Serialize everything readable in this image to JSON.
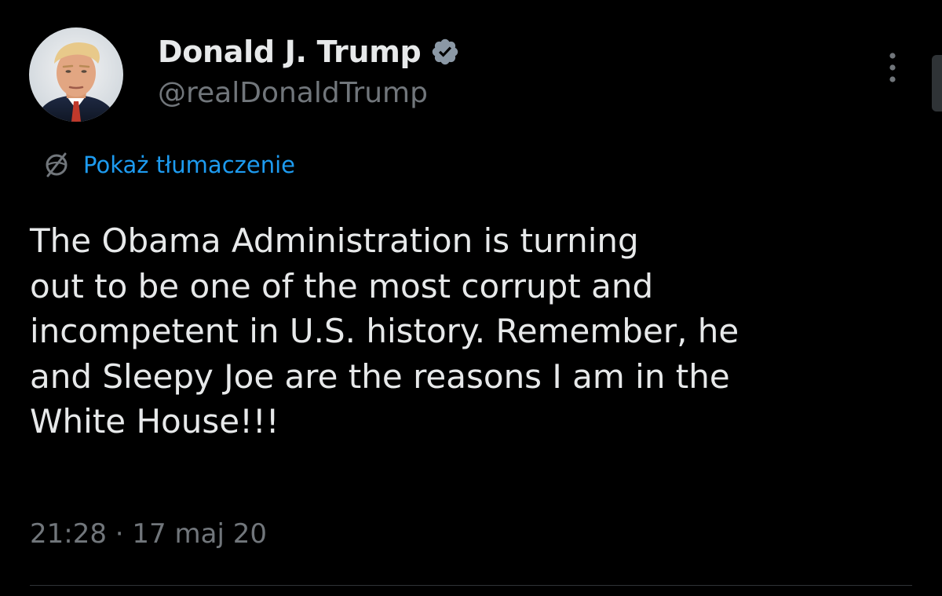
{
  "author": {
    "display_name": "Donald J. Trump",
    "handle": "@realDonaldTrump",
    "verified": true,
    "verified_color": "#8b98a5"
  },
  "translate": {
    "label": "Pokaż tłumaczenie",
    "color": "#1d9bf0"
  },
  "tweet": {
    "text": "The Obama Administration is turning\nout to be one of the most corrupt and\nincompetent in U.S. history. Remember, he\nand Sleepy Joe are the reasons I am in the\nWhite House!!!"
  },
  "meta": {
    "time": "21:28",
    "separator": "·",
    "date": "17 maj 20"
  },
  "icons": {
    "avatar": "profile-photo",
    "verified": "verified-badge-icon",
    "translate": "translate-globe-icon",
    "more": "more-vertical-icon"
  }
}
